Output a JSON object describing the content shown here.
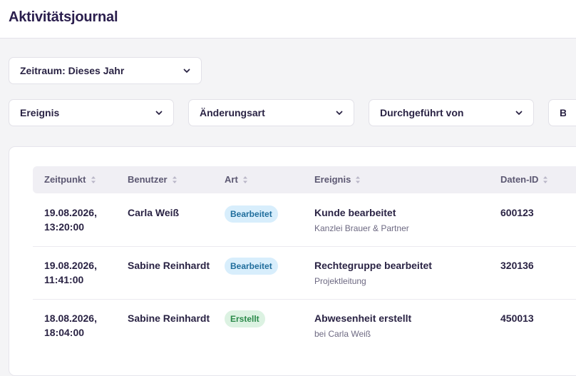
{
  "header": {
    "title": "Aktivitätsjournal"
  },
  "filters": {
    "zeitraum": {
      "label": "Zeitraum: Dieses Jahr"
    },
    "ereignis": {
      "label": "Ereignis"
    },
    "aenderungsart": {
      "label": "Änderungsart"
    },
    "durchgefuehrt_von": {
      "label": "Durchgeführt von"
    },
    "betroffen": {
      "label": "Bet"
    }
  },
  "table": {
    "columns": [
      "Zeitpunkt",
      "Benutzer",
      "Art",
      "Ereignis",
      "Daten-ID"
    ],
    "rows": [
      {
        "date": "19.08.2026,",
        "time": "13:20:00",
        "user": "Carla Weiß",
        "type": "Bearbeitet",
        "type_kind": "edit",
        "event": "Kunde bearbeitet",
        "event_detail": "Kanzlei Brauer & Partner",
        "data_id": "600123"
      },
      {
        "date": "19.08.2026,",
        "time": "11:41:00",
        "user": "Sabine Reinhardt",
        "type": "Bearbeitet",
        "type_kind": "edit",
        "event": "Rechtegruppe bearbeitet",
        "event_detail": "Projektleitung",
        "data_id": "320136"
      },
      {
        "date": "18.08.2026,",
        "time": "18:04:00",
        "user": "Sabine Reinhardt",
        "type": "Erstellt",
        "type_kind": "new",
        "event": "Abwesenheit erstellt",
        "event_detail": "bei Carla Weiß",
        "data_id": "450013"
      }
    ]
  },
  "icons": {
    "chevron": "chevron-down-icon",
    "sort": "sort-icon"
  },
  "colors": {
    "badge_edit_bg": "#d8eefc",
    "badge_edit_text": "#1f6d9c",
    "badge_new_bg": "#dcf2e2",
    "badge_new_text": "#2b8a4a"
  }
}
